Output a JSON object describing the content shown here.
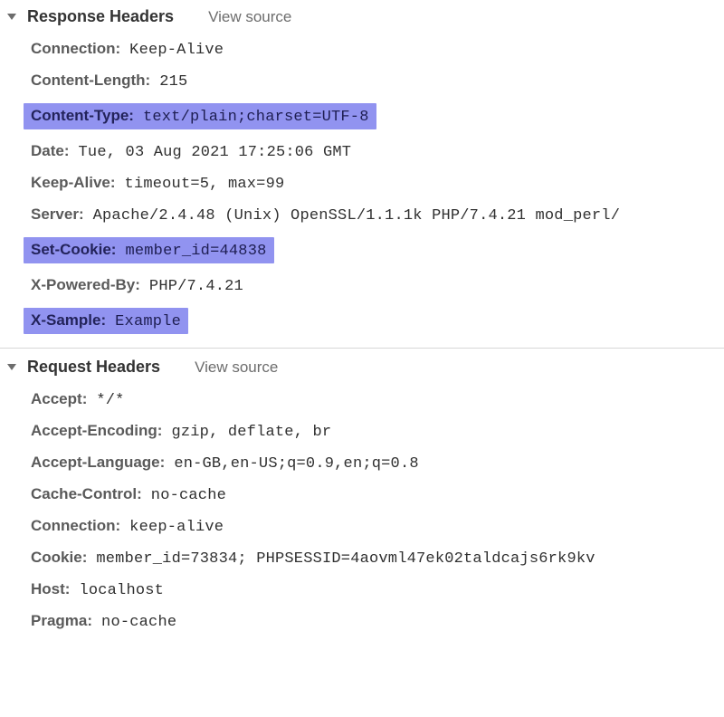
{
  "sections": {
    "response": {
      "title": "Response Headers",
      "view_source": "View source",
      "headers": [
        {
          "name": "Connection",
          "value": "Keep-Alive",
          "highlighted": false
        },
        {
          "name": "Content-Length",
          "value": "215",
          "highlighted": false
        },
        {
          "name": "Content-Type",
          "value": "text/plain;charset=UTF-8",
          "highlighted": true
        },
        {
          "name": "Date",
          "value": "Tue, 03 Aug 2021 17:25:06 GMT",
          "highlighted": false
        },
        {
          "name": "Keep-Alive",
          "value": "timeout=5, max=99",
          "highlighted": false
        },
        {
          "name": "Server",
          "value": "Apache/2.4.48 (Unix) OpenSSL/1.1.1k PHP/7.4.21 mod_perl/",
          "highlighted": false
        },
        {
          "name": "Set-Cookie",
          "value": "member_id=44838",
          "highlighted": true
        },
        {
          "name": "X-Powered-By",
          "value": "PHP/7.4.21",
          "highlighted": false
        },
        {
          "name": "X-Sample",
          "value": "Example",
          "highlighted": true
        }
      ]
    },
    "request": {
      "title": "Request Headers",
      "view_source": "View source",
      "headers": [
        {
          "name": "Accept",
          "value": "*/*",
          "highlighted": false
        },
        {
          "name": "Accept-Encoding",
          "value": "gzip, deflate, br",
          "highlighted": false
        },
        {
          "name": "Accept-Language",
          "value": "en-GB,en-US;q=0.9,en;q=0.8",
          "highlighted": false
        },
        {
          "name": "Cache-Control",
          "value": "no-cache",
          "highlighted": false
        },
        {
          "name": "Connection",
          "value": "keep-alive",
          "highlighted": false
        },
        {
          "name": "Cookie",
          "value": "member_id=73834; PHPSESSID=4aovml47ek02taldcajs6rk9kv",
          "highlighted": false
        },
        {
          "name": "Host",
          "value": "localhost",
          "highlighted": false
        },
        {
          "name": "Pragma",
          "value": "no-cache",
          "highlighted": false
        }
      ]
    }
  }
}
